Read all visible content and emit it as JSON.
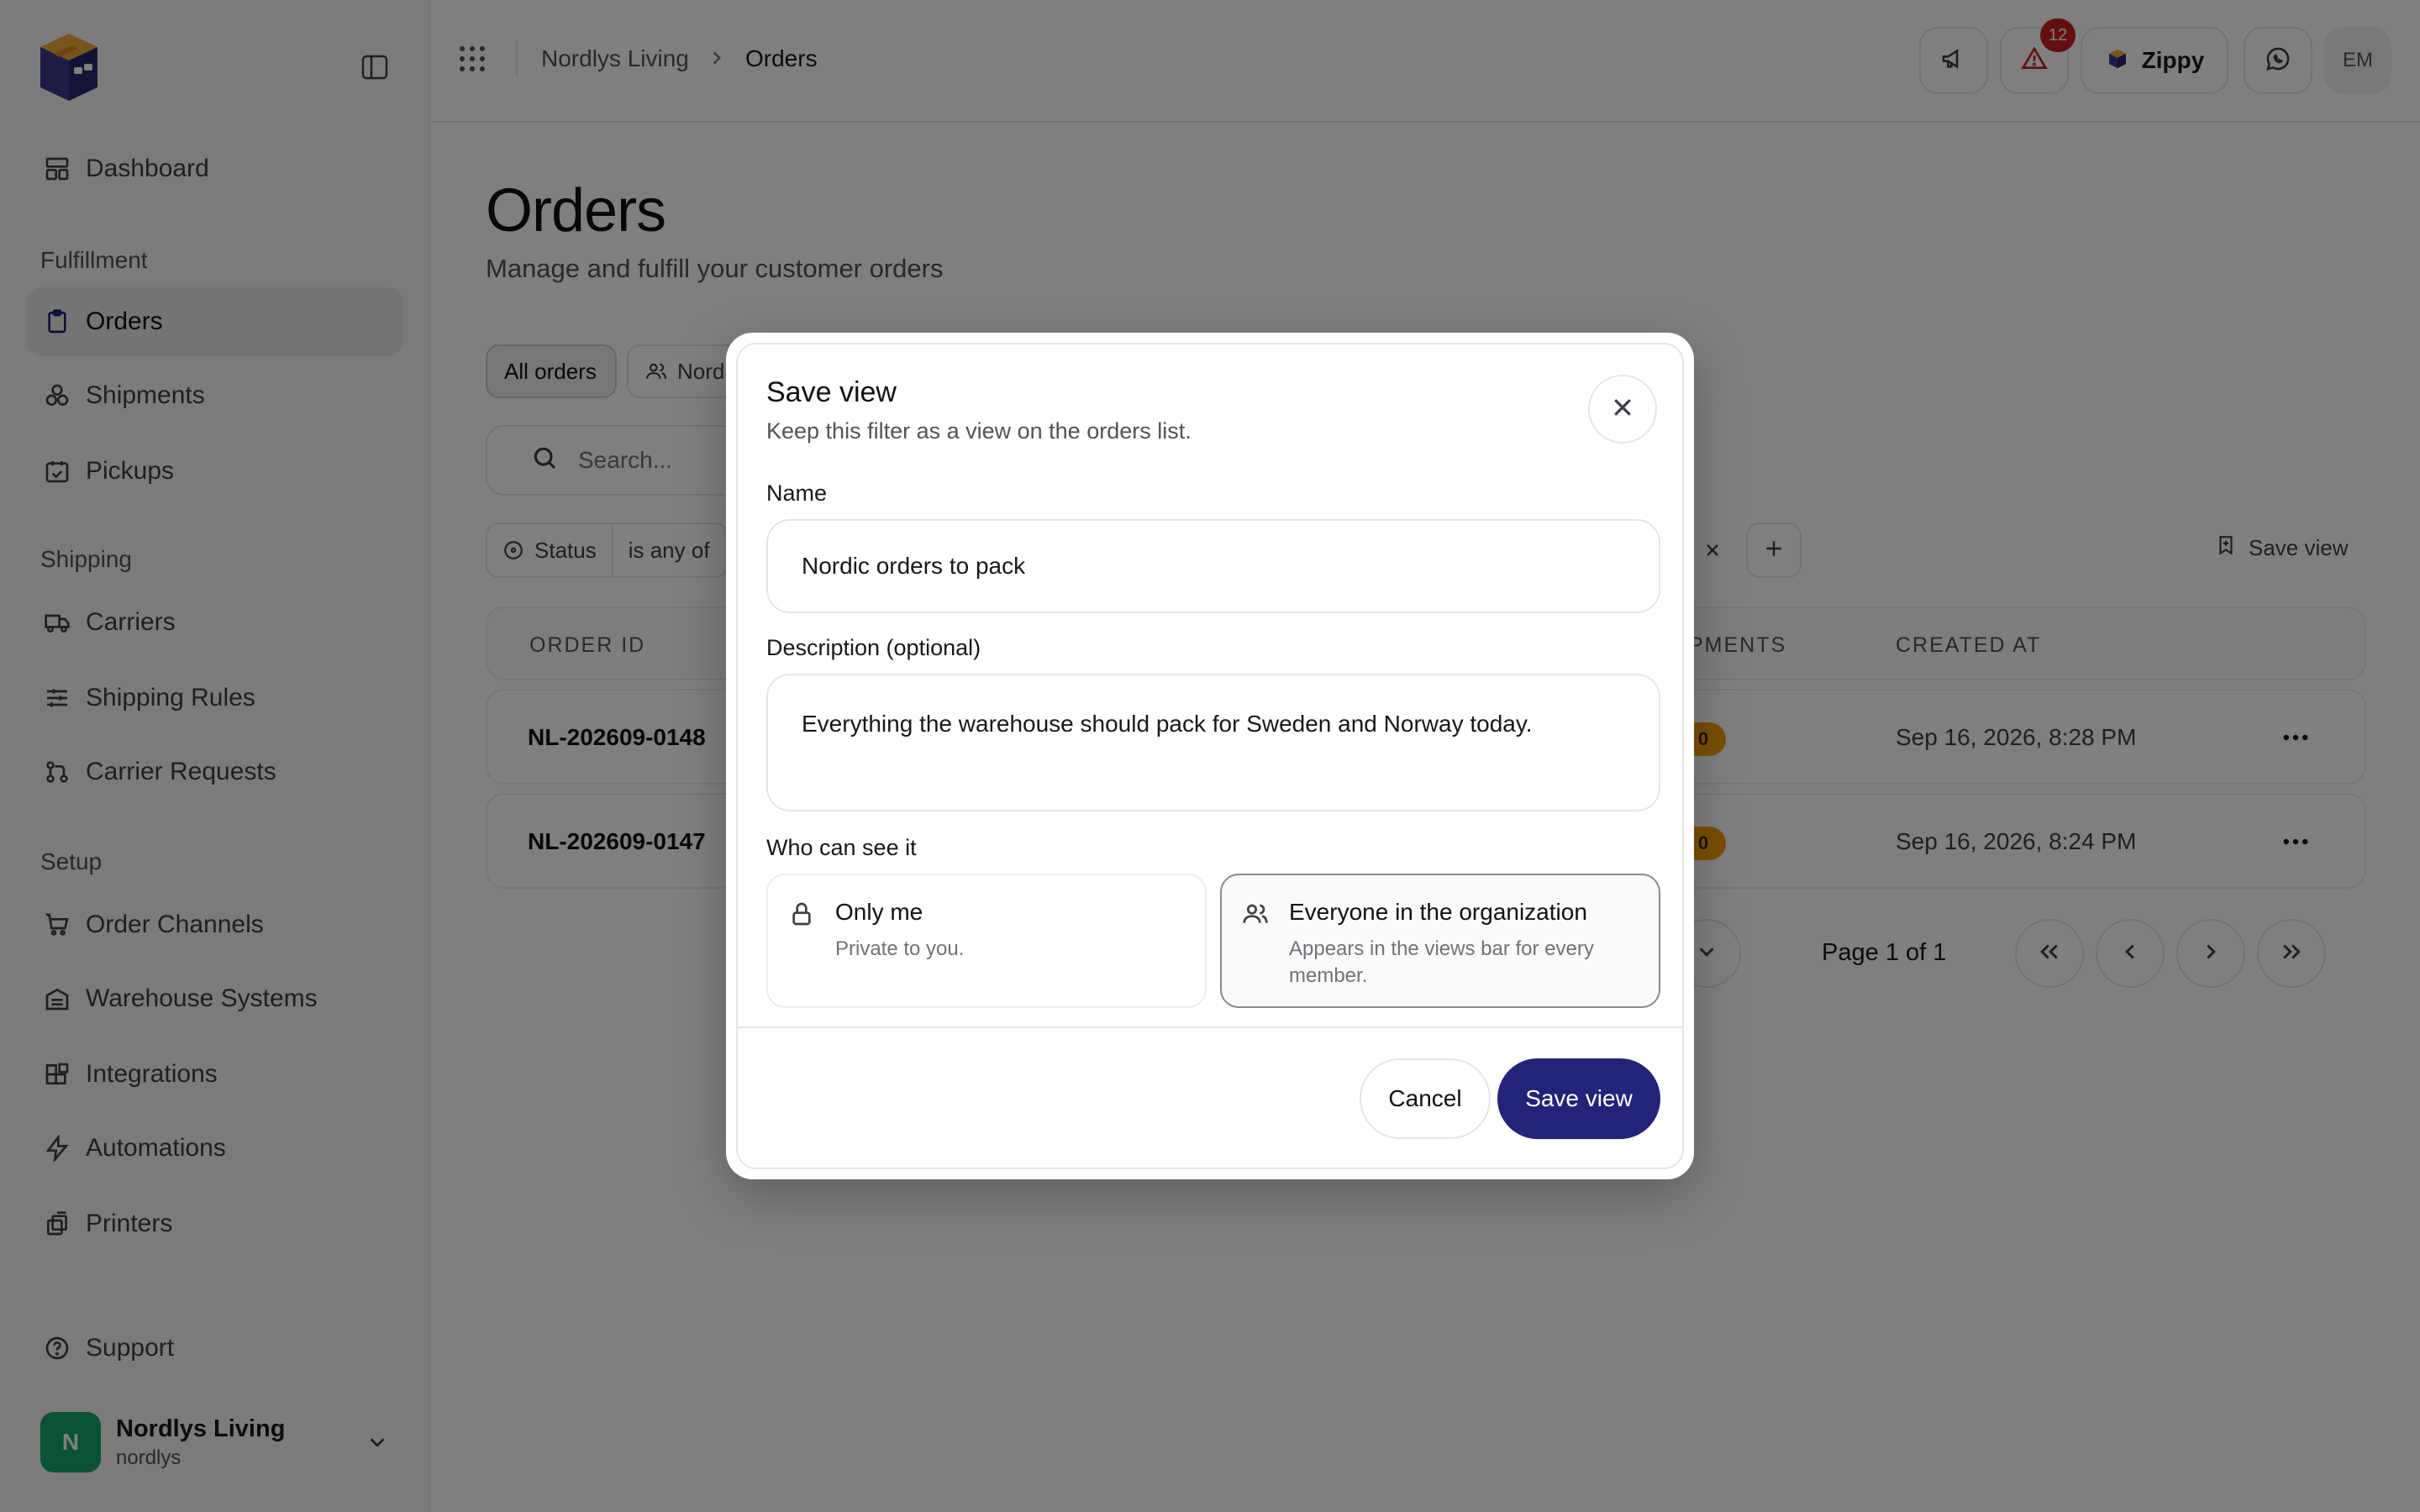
{
  "sidebar": {
    "top_items": [
      {
        "label": "Dashboard",
        "icon": "dashboard-icon"
      }
    ],
    "sections": [
      {
        "label": "Fulfillment",
        "items": [
          {
            "label": "Orders",
            "icon": "clipboard-icon",
            "active": true
          },
          {
            "label": "Shipments",
            "icon": "boxes-icon"
          },
          {
            "label": "Pickups",
            "icon": "calendar-check-icon"
          }
        ]
      },
      {
        "label": "Shipping",
        "items": [
          {
            "label": "Carriers",
            "icon": "truck-icon"
          },
          {
            "label": "Shipping Rules",
            "icon": "sliders-icon"
          },
          {
            "label": "Carrier Requests",
            "icon": "git-pull-icon"
          }
        ]
      },
      {
        "label": "Setup",
        "items": [
          {
            "label": "Order Channels",
            "icon": "cart-icon"
          },
          {
            "label": "Warehouse Systems",
            "icon": "warehouse-icon"
          },
          {
            "label": "Integrations",
            "icon": "blocks-icon"
          },
          {
            "label": "Automations",
            "icon": "zap-icon"
          },
          {
            "label": "Printers",
            "icon": "printer-icon"
          }
        ]
      }
    ],
    "support": "Support",
    "org": {
      "initial": "N",
      "name": "Nordlys Living",
      "slug": "nordlys",
      "color": "#16a36a"
    }
  },
  "topbar": {
    "breadcrumb": [
      "Nordlys Living",
      "Orders"
    ],
    "notification_count": "12",
    "zippy_label": "Zippy",
    "user_initials": "EM"
  },
  "page": {
    "title": "Orders",
    "subtitle": "Manage and fulfill your customer orders",
    "views": [
      "All orders",
      "Nord"
    ],
    "search_placeholder": "Search...",
    "filter": {
      "field": "Status",
      "operator": "is any of"
    },
    "save_view_label": "Save view"
  },
  "table": {
    "headers": [
      "ORDER ID",
      "PMENTS",
      "CREATED AT"
    ],
    "rows": [
      {
        "id": "NL-202609-0148",
        "shipments": "0",
        "created": "Sep 16, 2026, 8:28 PM"
      },
      {
        "id": "NL-202609-0147",
        "shipments": "0",
        "created": "Sep 16, 2026, 8:24 PM"
      }
    ],
    "page_info": "Page 1 of 1"
  },
  "modal": {
    "title": "Save view",
    "description": "Keep this filter as a view on the orders list.",
    "name_label": "Name",
    "name_value": "Nordic orders to pack",
    "desc_label": "Description (optional)",
    "desc_value": "Everything the warehouse should pack for Sweden and Norway today.",
    "visibility_label": "Who can see it",
    "options": [
      {
        "title": "Only me",
        "desc": "Private to you.",
        "selected": false
      },
      {
        "title": "Everyone in the organization",
        "desc": "Appears in the views bar for every member.",
        "selected": true
      }
    ],
    "cancel_label": "Cancel",
    "save_label": "Save view",
    "accent": "#23237a"
  }
}
